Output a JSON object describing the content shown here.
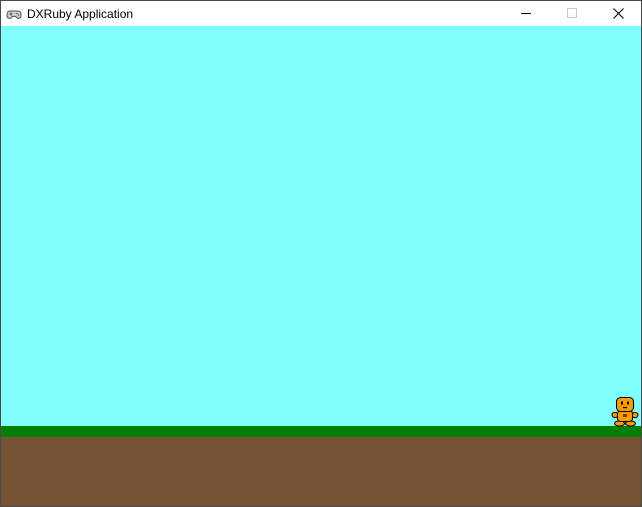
{
  "window": {
    "title": "DXRuby Application",
    "icon": "gamepad-icon",
    "controls": {
      "minimize_icon": "minimize-icon",
      "maximize_icon": "maximize-icon",
      "close_icon": "close-icon"
    }
  },
  "scene": {
    "colors": {
      "sky": "#80ffff",
      "grass": "#007f00",
      "dirt": "#745233",
      "player_body": "#ff9900",
      "player_outline": "#000000"
    },
    "player": {
      "sprite": "orange-robot-character"
    }
  }
}
